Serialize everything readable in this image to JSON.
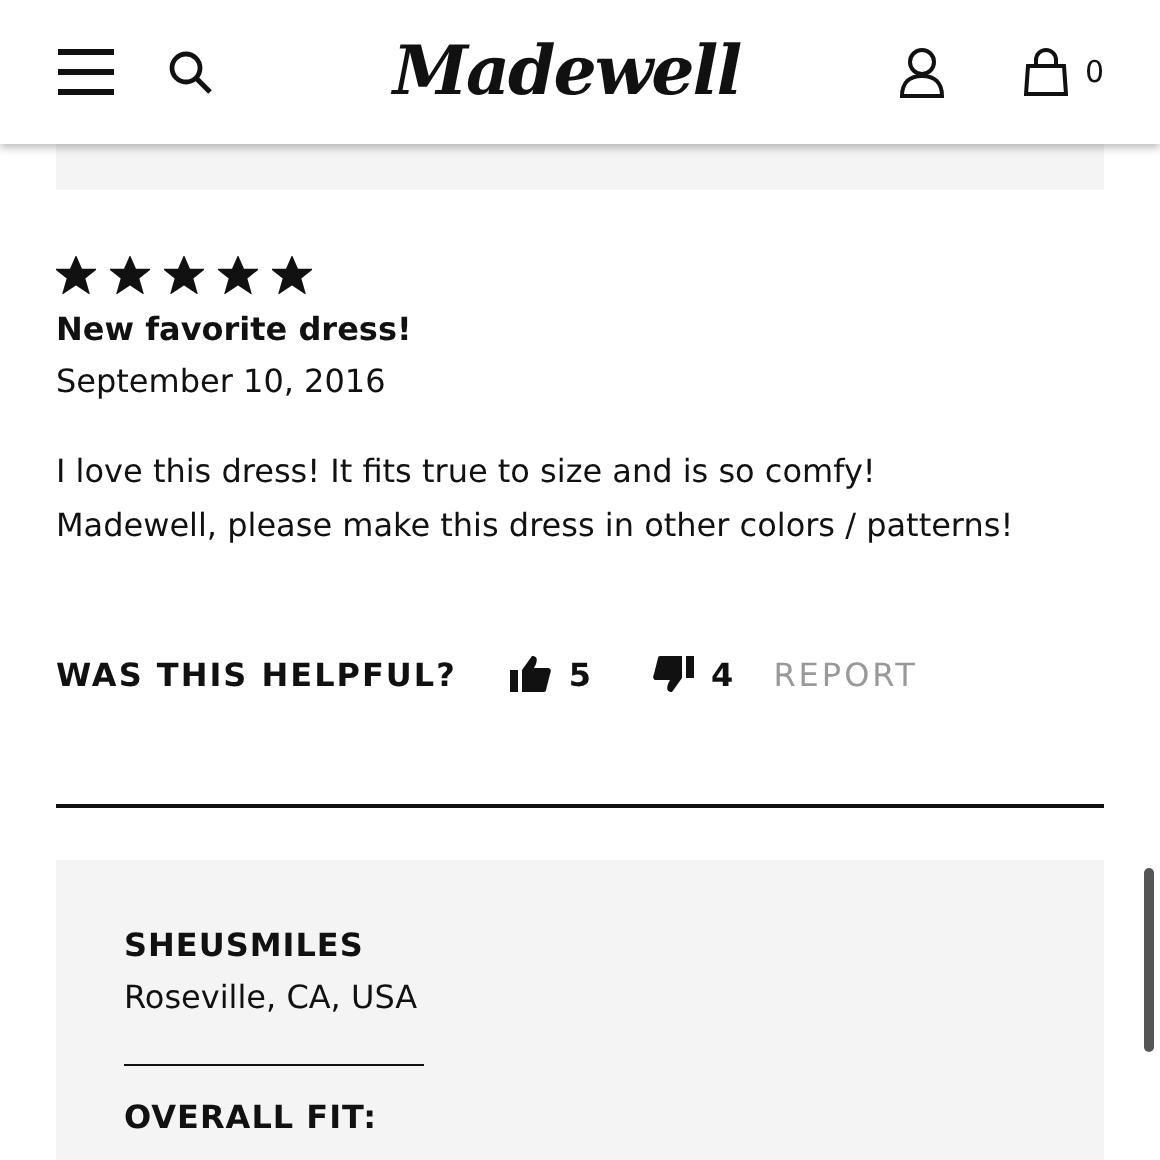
{
  "header": {
    "logo": "Madewell",
    "cart_count": "0"
  },
  "review": {
    "stars": 5,
    "title": "New favorite dress!",
    "date": "September 10, 2016",
    "body_lines": [
      "I love this dress! It fits true to size and is so comfy!",
      "Madewell, please make this dress in other colors / patterns!"
    ],
    "helpful_label": "WAS THIS HELPFUL?",
    "upvotes": "5",
    "downvotes": "4",
    "report": "REPORT"
  },
  "reviewer": {
    "name": "SHEUSMILES",
    "location": "Roseville, CA, USA",
    "fit_label": "OVERALL FIT:"
  }
}
